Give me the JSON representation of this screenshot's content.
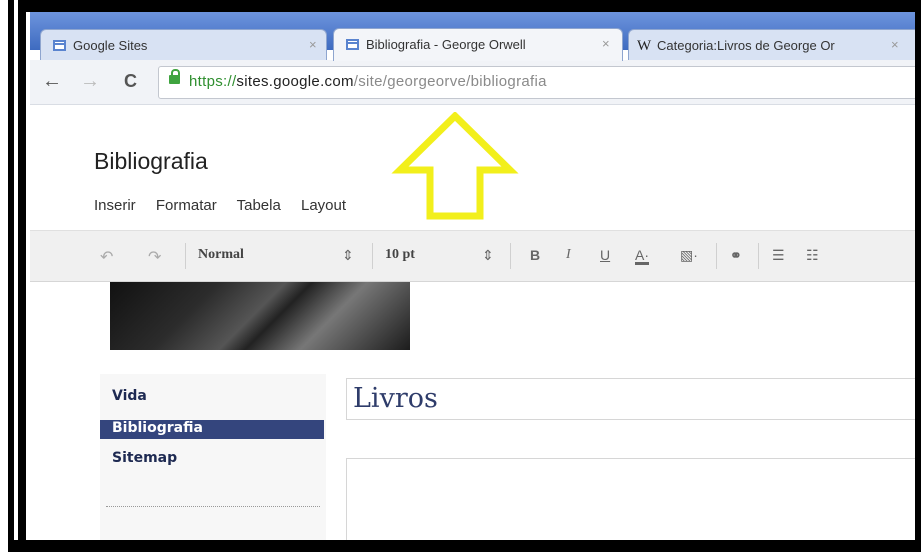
{
  "browser": {
    "tabs": [
      {
        "title": "Google Sites",
        "close": "×"
      },
      {
        "title": "Bibliografia - George Orwell",
        "close": "×"
      },
      {
        "title": "Categoria:Livros de George Or",
        "close": "×",
        "favicon_text": "W"
      }
    ],
    "nav": {
      "back": "←",
      "forward": "→",
      "reload": "C"
    },
    "url": {
      "scheme": "https://",
      "host": "sites.google.com",
      "path": "/site/georgeorve/bibliografia"
    }
  },
  "site": {
    "title": "Bibliografia",
    "menu": [
      "Inserir",
      "Formatar",
      "Tabela",
      "Layout"
    ]
  },
  "editor": {
    "undo": "↶",
    "redo": "↷",
    "style": "Normal",
    "style_arrow": "⇕",
    "size": "10 pt",
    "size_arrow": "⇕",
    "bold": "B",
    "italic": "I",
    "underline": "U",
    "text_color": "A·",
    "highlight": "▧·",
    "link": "⚭",
    "numbered_list": "☰",
    "bullet_list": "☷"
  },
  "sidebar": {
    "items": [
      {
        "label": "Vida"
      },
      {
        "label": "Bibliografia"
      },
      {
        "label": "Sitemap"
      }
    ]
  },
  "content": {
    "heading": "Livros"
  },
  "annotation": {
    "color": "#f2ef1b"
  }
}
